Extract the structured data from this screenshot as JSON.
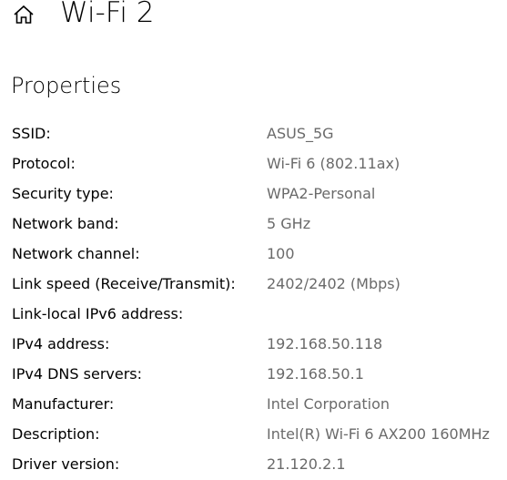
{
  "header": {
    "home_icon": "home-icon",
    "title": "Wi-Fi 2"
  },
  "section": {
    "title": "Properties"
  },
  "properties": [
    {
      "label": "SSID:",
      "value": "ASUS_5G"
    },
    {
      "label": "Protocol:",
      "value": "Wi-Fi 6 (802.11ax)"
    },
    {
      "label": "Security type:",
      "value": "WPA2-Personal"
    },
    {
      "label": "Network band:",
      "value": "5 GHz"
    },
    {
      "label": "Network channel:",
      "value": "100"
    },
    {
      "label": "Link speed (Receive/Transmit):",
      "value": "2402/2402 (Mbps)"
    },
    {
      "label": "Link-local IPv6 address:",
      "value": ""
    },
    {
      "label": "IPv4 address:",
      "value": "192.168.50.118"
    },
    {
      "label": "IPv4 DNS servers:",
      "value": "192.168.50.1"
    },
    {
      "label": "Manufacturer:",
      "value": "Intel Corporation"
    },
    {
      "label": "Description:",
      "value": "Intel(R) Wi-Fi 6 AX200 160MHz"
    },
    {
      "label": "Driver version:",
      "value": "21.120.2.1"
    }
  ],
  "colors": {
    "label_text": "#000000",
    "value_text": "#6a6a6a",
    "background": "#ffffff"
  }
}
